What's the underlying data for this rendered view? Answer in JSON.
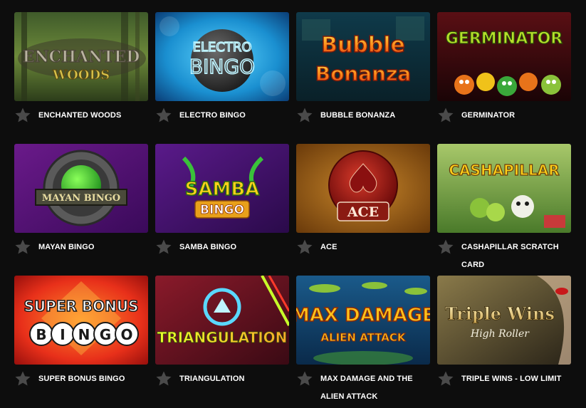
{
  "games": [
    {
      "title": "ENCHANTED WOODS",
      "logo": "Enchanted Woods"
    },
    {
      "title": "ELECTRO BINGO",
      "logo": "Electro Bingo"
    },
    {
      "title": "BUBBLE BONANZA",
      "logo": "Bubble Bonanza"
    },
    {
      "title": "GERMINATOR",
      "logo": "GERMINATOR"
    },
    {
      "title": "MAYAN BINGO",
      "logo": "MAYAN BINGO"
    },
    {
      "title": "SAMBA BINGO",
      "logo": "SAMBA BINGO"
    },
    {
      "title": "ACE",
      "logo": "ACE"
    },
    {
      "title": "CASHAPILLAR SCRATCH CARD",
      "logo": "CASHAPILLAR"
    },
    {
      "title": "SUPER BONUS BINGO",
      "logo": "SUPER BONUS BINGO"
    },
    {
      "title": "TRIANGULATION",
      "logo": "TRIANGULATION"
    },
    {
      "title": "MAX DAMAGE AND THE ALIEN ATTACK",
      "logo": "MAX DAMAGE AND THE ALIEN ATTACK"
    },
    {
      "title": "TRIPLE WINS - LOW LIMIT",
      "logo": "Triple Wins High Roller"
    }
  ],
  "colors": {
    "background": "#0d0d0d",
    "title_text": "#ffffff",
    "star_icon": "#4a4a4a"
  }
}
